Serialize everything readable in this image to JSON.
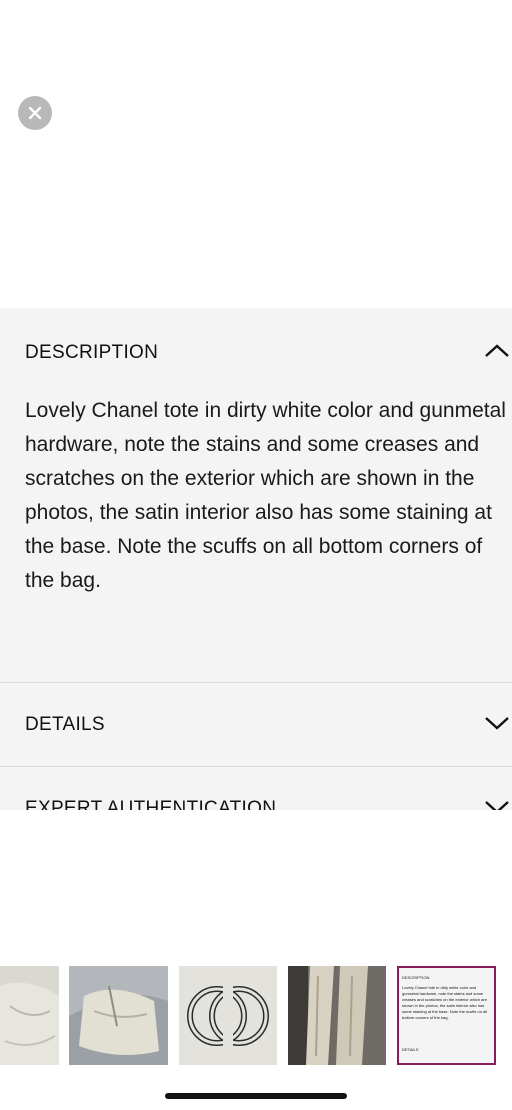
{
  "description": {
    "title": "DESCRIPTION",
    "text": "Lovely Chanel tote in dirty white color and gunmetal hardware, note the stains and some creases and scratches on the exterior which are shown in the photos, the satin interior also has some staining at the base. Note the scuffs on all bottom corners of the bag."
  },
  "details": {
    "title": "DETAILS"
  },
  "authentication": {
    "title": "EXPERT AUTHENTICATION"
  },
  "thumbnails": {
    "selected_index": 4,
    "items": [
      "bag-photo-1",
      "bag-photo-2",
      "chanel-logo-photo",
      "handle-photo",
      "description-screenshot"
    ],
    "mini_preview": {
      "title": "DESCRIPTION",
      "text": "Lovely Chanel tote in dirty white color and gunmetal hardware, note the stains and some creases and scratches on the exterior which are shown in the photos, the satin interior also has some staining at the base. Note the scuffs on all bottom corners of the bag.",
      "details": "DETAILS"
    }
  },
  "colors": {
    "panel_bg": "#f4f4f4",
    "selected_border": "#8a1a5a",
    "close_bg": "#b8b8b8"
  },
  "icons": {
    "close": "close-icon",
    "collapse": "chevron-up-icon",
    "expand": "chevron-down-icon"
  }
}
